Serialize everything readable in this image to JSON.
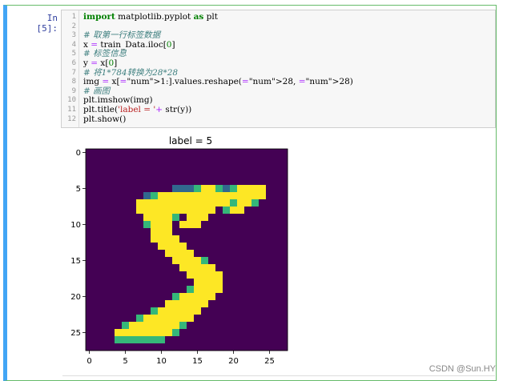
{
  "cell": {
    "prompt": "In  [5]:"
  },
  "code_lines": [
    {
      "n": "1",
      "text": "import matplotlib.pyplot as plt"
    },
    {
      "n": "2",
      "text": ""
    },
    {
      "n": "3",
      "text": "# 取第一行标签数据"
    },
    {
      "n": "4",
      "text": "x = train_Data.iloc[0]"
    },
    {
      "n": "5",
      "text": "# 标签信息"
    },
    {
      "n": "6",
      "text": "y = x[0]"
    },
    {
      "n": "7",
      "text": "# 将1*784转换为28*28"
    },
    {
      "n": "8",
      "text": "img = x[1:].values.reshape(28, 28)"
    },
    {
      "n": "9",
      "text": "# 画图"
    },
    {
      "n": "10",
      "text": "plt.imshow(img)"
    },
    {
      "n": "11",
      "text": "plt.title('label = '+ str(y))"
    },
    {
      "n": "12",
      "text": "plt.show()"
    }
  ],
  "chart_data": {
    "type": "heatmap",
    "title": "label = 5",
    "xticks": [
      "0",
      "5",
      "10",
      "15",
      "20",
      "25"
    ],
    "yticks": [
      "0",
      "5",
      "10",
      "15",
      "20",
      "25"
    ],
    "xlim": [
      -0.5,
      27.5
    ],
    "ylim": [
      27.5,
      -0.5
    ],
    "colormap": "viridis",
    "colors": {
      "background": "#440154",
      "low": "#31688e",
      "mid": "#35b779",
      "high": "#fde725"
    },
    "rows": [
      "............................",
      "............................",
      "............................",
      "............................",
      "............................",
      "............lllmhhmlmhhhh...",
      "........lmhhhhhhhhhhhhhhh...",
      ".......hhhhhhhhhhhhhmhhm....",
      ".......hhhhhhhhhhh.mhh......",
      "........hhhhm.hhh...........",
      "........mhhh.hhh............",
      ".........hhh................",
      ".........hhhh...............",
      "..........hhhh..............",
      "...........hhhh.............",
      "............hhhhm...........",
      ".............hhhhh..........",
      "..............hhhhh.........",
      "...............hhhh.........",
      "..............mhhhh.........",
      "............mhhhhh..........",
      "...........hhhhhh...........",
      ".........mhhhhhh............",
      ".......mhhhhhhh.............",
      ".....mhhhhhhhm..............",
      "....hhhhhhhhm...............",
      "....mmmmmmm.................",
      "............................"
    ]
  },
  "watermark": "CSDN @Sun.HY"
}
